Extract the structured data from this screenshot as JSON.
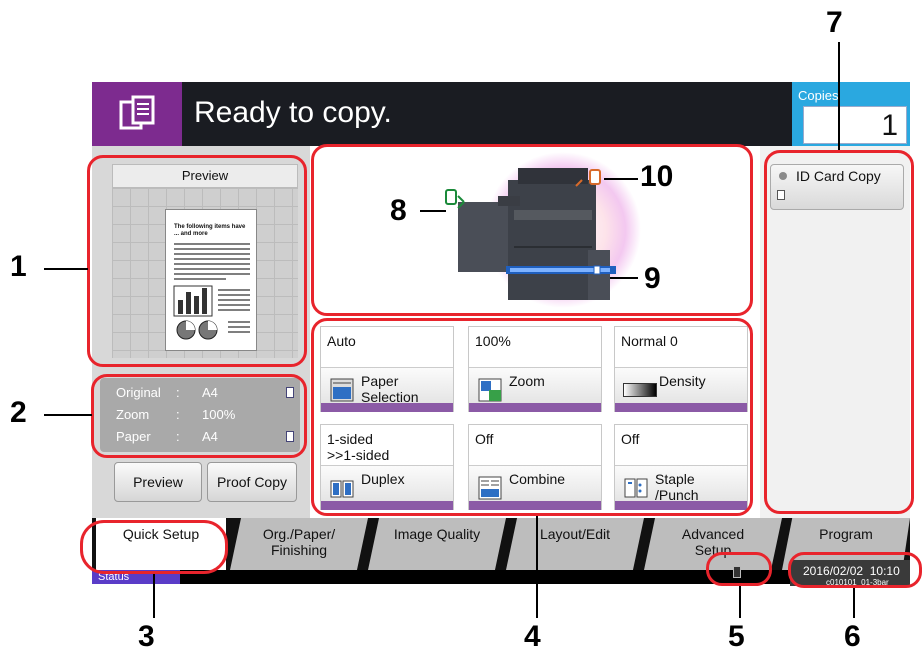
{
  "header": {
    "title": "Ready to copy.",
    "copies_label": "Copies",
    "copies_value": "1"
  },
  "preview": {
    "title": "Preview",
    "doc_heading": "The following items have ... and more"
  },
  "info": {
    "original_label": "Original",
    "original_value": "A4",
    "zoom_label": "Zoom",
    "zoom_value": "100%",
    "paper_label": "Paper",
    "paper_value": "A4"
  },
  "left_buttons": {
    "preview": "Preview",
    "proof_copy": "Proof Copy"
  },
  "functions": [
    {
      "value": "Auto",
      "label": "Paper\nSelection"
    },
    {
      "value": "100%",
      "label": "Zoom"
    },
    {
      "value": "Normal 0",
      "label": "Density"
    },
    {
      "value": "1-sided\n>>1-sided",
      "label": "Duplex"
    },
    {
      "value": "Off",
      "label": "Combine"
    },
    {
      "value": "Off",
      "label": "Staple\n/Punch"
    }
  ],
  "shortcut": {
    "id_card_copy": "ID Card Copy"
  },
  "tabs": [
    {
      "label": "Quick Setup"
    },
    {
      "label": "Org./Paper/\nFinishing"
    },
    {
      "label": "Image Quality"
    },
    {
      "label": "Layout/Edit"
    },
    {
      "label": "Advanced\nSetup"
    },
    {
      "label": "Program"
    }
  ],
  "status": {
    "label": "Status",
    "datetime": "2016/02/02  10:10",
    "code": "c010101_01-3bar"
  },
  "callouts": [
    "1",
    "2",
    "3",
    "4",
    "5",
    "6",
    "7",
    "8",
    "9",
    "10"
  ],
  "colors": {
    "accent_purple": "#7d2b8f",
    "copies_blue": "#2aa8e0",
    "callout_red": "#e8242c",
    "tile_bar": "#8b5aa6"
  }
}
